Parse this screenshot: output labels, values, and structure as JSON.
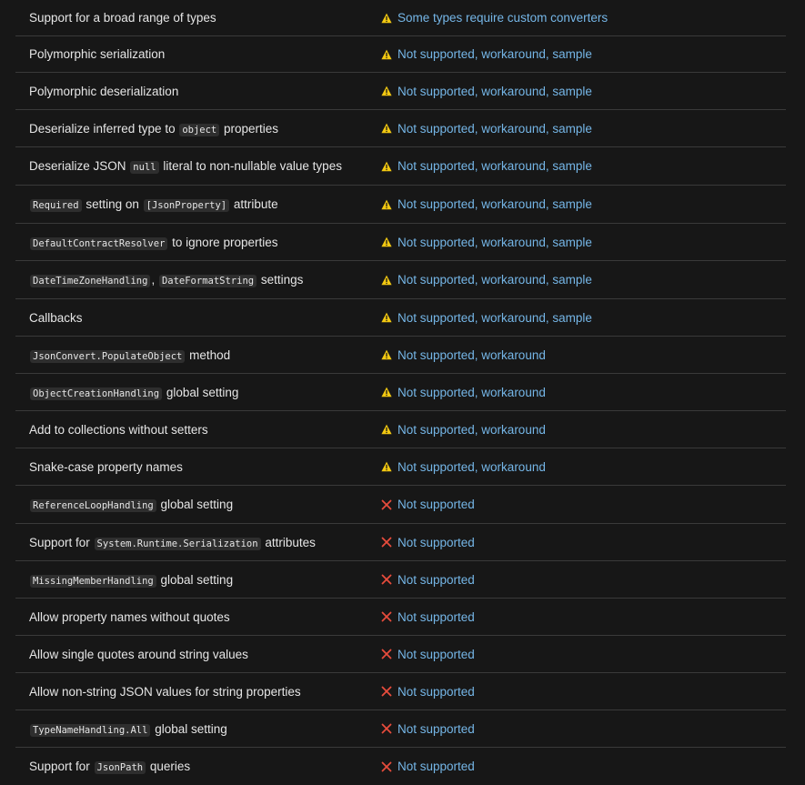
{
  "colors": {
    "background": "#171717",
    "text": "#e6e6e6",
    "link": "#75b6e7",
    "warning": "#f2c811",
    "error": "#e74c3c",
    "divider": "#3a3a3a",
    "code_bg": "#2e2e2e"
  },
  "rows": [
    {
      "feature": [
        {
          "t": "Support for a broad range of types"
        }
      ],
      "status_icon": "warning-icon",
      "status": "Some types require custom converters"
    },
    {
      "feature": [
        {
          "t": "Polymorphic serialization"
        }
      ],
      "status_icon": "warning-icon",
      "status": "Not supported, workaround, sample"
    },
    {
      "feature": [
        {
          "t": "Polymorphic deserialization"
        }
      ],
      "status_icon": "warning-icon",
      "status": "Not supported, workaround, sample"
    },
    {
      "feature": [
        {
          "t": "Deserialize inferred type to "
        },
        {
          "c": "object"
        },
        {
          "t": " properties"
        }
      ],
      "status_icon": "warning-icon",
      "status": "Not supported, workaround, sample"
    },
    {
      "feature": [
        {
          "t": "Deserialize JSON "
        },
        {
          "c": "null"
        },
        {
          "t": " literal to non-nullable value types"
        }
      ],
      "status_icon": "warning-icon",
      "status": "Not supported, workaround, sample"
    },
    {
      "feature": [
        {
          "c": "Required"
        },
        {
          "t": " setting on "
        },
        {
          "c": "[JsonProperty]"
        },
        {
          "t": " attribute"
        }
      ],
      "status_icon": "warning-icon",
      "status": "Not supported, workaround, sample"
    },
    {
      "feature": [
        {
          "c": "DefaultContractResolver"
        },
        {
          "t": " to ignore properties"
        }
      ],
      "status_icon": "warning-icon",
      "status": "Not supported, workaround, sample"
    },
    {
      "feature": [
        {
          "c": "DateTimeZoneHandling"
        },
        {
          "t": ", "
        },
        {
          "c": "DateFormatString"
        },
        {
          "t": " settings"
        }
      ],
      "status_icon": "warning-icon",
      "status": "Not supported, workaround, sample"
    },
    {
      "feature": [
        {
          "t": "Callbacks"
        }
      ],
      "status_icon": "warning-icon",
      "status": "Not supported, workaround, sample"
    },
    {
      "feature": [
        {
          "c": "JsonConvert.PopulateObject"
        },
        {
          "t": " method"
        }
      ],
      "status_icon": "warning-icon",
      "status": "Not supported, workaround"
    },
    {
      "feature": [
        {
          "c": "ObjectCreationHandling"
        },
        {
          "t": " global setting"
        }
      ],
      "status_icon": "warning-icon",
      "status": "Not supported, workaround"
    },
    {
      "feature": [
        {
          "t": "Add to collections without setters"
        }
      ],
      "status_icon": "warning-icon",
      "status": "Not supported, workaround"
    },
    {
      "feature": [
        {
          "t": "Snake-case property names"
        }
      ],
      "status_icon": "warning-icon",
      "status": "Not supported, workaround"
    },
    {
      "feature": [
        {
          "c": "ReferenceLoopHandling"
        },
        {
          "t": " global setting"
        }
      ],
      "status_icon": "x-icon",
      "status": "Not supported"
    },
    {
      "feature": [
        {
          "t": "Support for "
        },
        {
          "c": "System.Runtime.Serialization"
        },
        {
          "t": " attributes"
        }
      ],
      "status_icon": "x-icon",
      "status": "Not supported"
    },
    {
      "feature": [
        {
          "c": "MissingMemberHandling"
        },
        {
          "t": " global setting"
        }
      ],
      "status_icon": "x-icon",
      "status": "Not supported"
    },
    {
      "feature": [
        {
          "t": "Allow property names without quotes"
        }
      ],
      "status_icon": "x-icon",
      "status": "Not supported"
    },
    {
      "feature": [
        {
          "t": "Allow single quotes around string values"
        }
      ],
      "status_icon": "x-icon",
      "status": "Not supported"
    },
    {
      "feature": [
        {
          "t": "Allow non-string JSON values for string properties"
        }
      ],
      "status_icon": "x-icon",
      "status": "Not supported"
    },
    {
      "feature": [
        {
          "c": "TypeNameHandling.All"
        },
        {
          "t": " global setting"
        }
      ],
      "status_icon": "x-icon",
      "status": "Not supported"
    },
    {
      "feature": [
        {
          "t": "Support for "
        },
        {
          "c": "JsonPath"
        },
        {
          "t": " queries"
        }
      ],
      "status_icon": "x-icon",
      "status": "Not supported"
    }
  ]
}
